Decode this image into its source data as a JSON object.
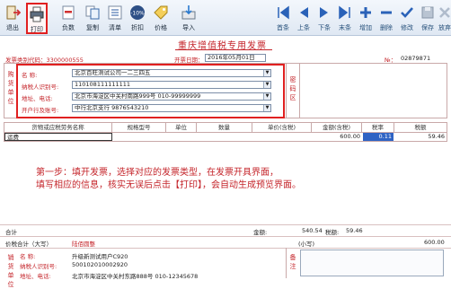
{
  "toolbar": {
    "left": [
      {
        "name": "exit-button",
        "icon": "exit-icon",
        "label": "退出"
      },
      {
        "name": "print-button",
        "icon": "printer-icon",
        "label": "打印"
      },
      {
        "name": "negative-invoice-button",
        "icon": "negative-invoice-icon",
        "label": "负数"
      },
      {
        "name": "copy-button",
        "icon": "copy-icon",
        "label": "复制"
      },
      {
        "name": "list-button",
        "icon": "list-icon",
        "label": "清单"
      },
      {
        "name": "discount-button",
        "icon": "discount-icon",
        "label": "折扣",
        "badge": "-10%"
      },
      {
        "name": "price-button",
        "icon": "price-icon",
        "label": "价格"
      },
      {
        "name": "import-button",
        "icon": "import-icon",
        "label": "导入"
      }
    ],
    "nav": [
      {
        "name": "first-button",
        "icon": "first-page-icon",
        "label": "首条"
      },
      {
        "name": "prev-button",
        "icon": "previous-icon",
        "label": "上条"
      },
      {
        "name": "next-button",
        "icon": "next-icon",
        "label": "下条"
      },
      {
        "name": "last-button",
        "icon": "last-page-icon",
        "label": "末条"
      },
      {
        "name": "add-button",
        "icon": "plus-icon",
        "label": "增加"
      },
      {
        "name": "delete-button",
        "icon": "minus-icon",
        "label": "删除"
      },
      {
        "name": "modify-button",
        "icon": "check-icon",
        "label": "修改"
      },
      {
        "name": "save-button",
        "icon": "save-icon",
        "label": "保存"
      },
      {
        "name": "cancel-button",
        "icon": "close-icon",
        "label": "放弃"
      }
    ]
  },
  "invoice": {
    "title": "重庆增值税专用发票",
    "category_label": "发票类别代码：3300000555",
    "date_label": "开票日期：",
    "date_value": "2016年05月01日",
    "no_label": "№：",
    "no_value": "02879871",
    "buyer_side_label": "购货单位",
    "cipher_label": "密码区",
    "buyer_name_label": "名      称:",
    "buyer_name": "北京百旺测试公司一二三四五",
    "buyer_taxid_label": "纳税人识别号:",
    "buyer_taxid": "110108111111111",
    "buyer_addr_label": "地址、电话:",
    "buyer_addr": "北京市海淀区中关村南路999号 010-99999999",
    "buyer_bank_label": "开户行及账号:",
    "buyer_bank": "中行北京支行 9876543210",
    "col_goods": "货物或应税劳务名称",
    "col_spec": "规格型号",
    "col_unit": "单位",
    "col_qty": "数量",
    "col_price": "单价(含税)",
    "col_amount": "金额(含税)",
    "col_rate": "税率",
    "col_tax": "税额",
    "row_goods": "运费",
    "row_amount": "600.00",
    "row_rate": "0.11",
    "row_tax": "59.46",
    "instructions_line1": "第一步：填开发票，选择对应的发票类型，在发票开具界面，",
    "instructions_line2": "填写相应的信息，核实无误后点击【打印】，会自动生成预览界面。",
    "total_label": "合计",
    "sum_label": "金额:",
    "sum_amount": "540.54",
    "tax_label": "税额:",
    "tax_total": "59.46",
    "grand_label": "价税合计（大写）",
    "grand_cn": "陆佰圆整",
    "small_label": "(小写)",
    "grand_num": "600.00",
    "seller_side_label": "销货单位",
    "seller_name_label": "名      称:",
    "seller_name": "升级新测试用户C920",
    "seller_taxid_label": "纳税人识别号:",
    "seller_taxid": "500102010002920",
    "seller_addr_label": "地址、电话:",
    "seller_addr": "北京市海淀区中关村东路888号 010-12345678",
    "remark_label": "备注"
  }
}
